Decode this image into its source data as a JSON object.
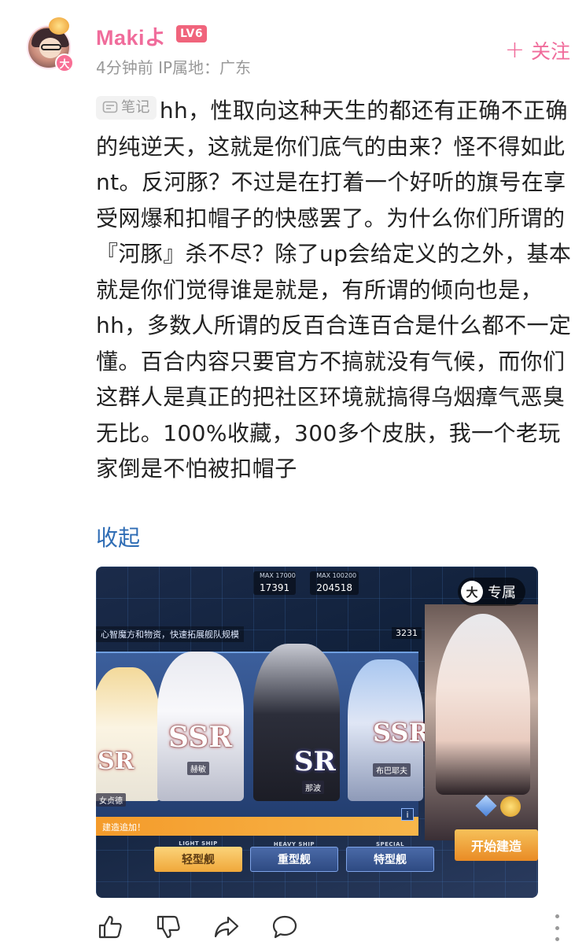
{
  "author": {
    "name": "Makiよ",
    "level": "LV6",
    "avatar_badge": "大",
    "meta": "4分钟前  IP属地：广东"
  },
  "follow_label": "关注",
  "post": {
    "tag_label": "笔记",
    "body": "hh，性取向这种天生的都还有正确不正确的纯逆天，这就是你们底气的由来？怪不得如此nt。反河豚？不过是在打着一个好听的旗号在享受网爆和扣帽子的快感罢了。为什么你们所谓的『河豚』杀不尽？除了up会给定义的之外，基本就是你们觉得谁是就是，有所谓的倾向也是，hh，多数人所谓的反百合连百合是什么都不一定懂。百合内容只要官方不搞就没有气候，而你们这群人是真正的把社区环境就搞得乌烟瘴气恶臭无比。100%收藏，300多个皮肤，我一个老玩家倒是不怕被扣帽子",
    "collapse_label": "收起"
  },
  "image": {
    "badge_label": "专属",
    "badge_icon": "大",
    "stat1_max": "MAX 17000",
    "stat1_value": "17391",
    "stat2_max": "MAX 100200",
    "stat2_value": "204518",
    "banner": "心智魔方和物资，快速拓展舰队规模",
    "count": "3231",
    "ranks": [
      "SR",
      "SSR",
      "SR",
      "SSR"
    ],
    "names": [
      "女贞德",
      "赫敏",
      "那波",
      "布巴耶夫"
    ],
    "strip_text": "建造追加！",
    "info_icon": "i",
    "tabs": [
      {
        "sub": "LIGHT SHIP",
        "label": "轻型舰"
      },
      {
        "sub": "HEAVY SHIP",
        "label": "重型舰"
      },
      {
        "sub": "SPECIAL",
        "label": "特型舰"
      }
    ],
    "build_label": "开始建造"
  },
  "actions": {
    "icons": [
      "thumbs-up-icon",
      "thumbs-down-icon",
      "share-icon",
      "comment-icon",
      "more-icon"
    ]
  },
  "colors": {
    "accent_pink": "#f06c9b",
    "link_blue": "#2f6db5",
    "level_red": "#f0647c",
    "meta_gray": "#999999"
  }
}
